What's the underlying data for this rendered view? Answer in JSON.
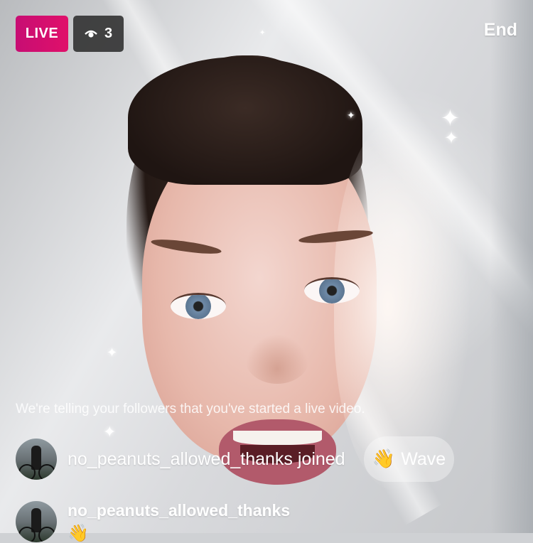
{
  "status": {
    "live_label": "LIVE",
    "viewer_icon": "eye-icon",
    "viewer_count": "3",
    "end_label": "End"
  },
  "notice": "We're telling your followers that you've started a live video.",
  "joined_event": {
    "avatar": "user-avatar",
    "text": "no_peanuts_allowed_thanks joined",
    "wave_emoji": "👋",
    "wave_label": "Wave"
  },
  "comment": {
    "avatar": "user-avatar",
    "username": "no_peanuts_allowed_thanks",
    "text": "👋"
  },
  "colors": {
    "live_badge": "#d80e6f",
    "viewer_badge": "#2a2a2a"
  }
}
